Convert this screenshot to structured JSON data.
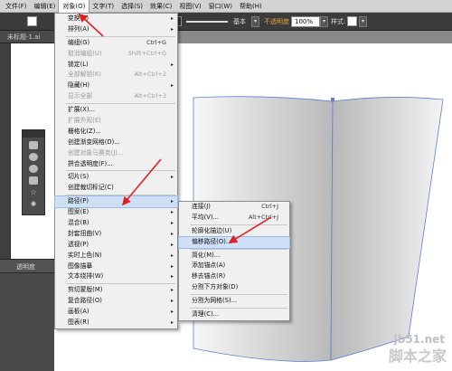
{
  "menubar": {
    "items": [
      "文件(F)",
      "编辑(E)",
      "对象(O)",
      "文字(T)",
      "选择(S)",
      "效果(C)",
      "视图(V)",
      "窗口(W)",
      "帮助(H)"
    ],
    "active_index": 2
  },
  "control_bar": {
    "stroke_profile": "基本",
    "opacity_label": "不透明度",
    "opacity_value": "100%",
    "style_label": "样式:"
  },
  "document_tab": "未标题-1.ai",
  "panel_header": "透明度",
  "object_menu": {
    "items": [
      {
        "label": "变换(T)",
        "submenu": true
      },
      {
        "label": "排列(A)",
        "submenu": true
      },
      {
        "sep": true
      },
      {
        "label": "编组(G)",
        "shortcut": "Ctrl+G"
      },
      {
        "label": "取消编组(U)",
        "shortcut": "Shift+Ctrl+G",
        "disabled": true
      },
      {
        "label": "锁定(L)",
        "submenu": true
      },
      {
        "label": "全部解锁(K)",
        "shortcut": "Alt+Ctrl+2",
        "disabled": true
      },
      {
        "label": "隐藏(H)",
        "submenu": true
      },
      {
        "label": "显示全部",
        "shortcut": "Alt+Ctrl+3",
        "disabled": true
      },
      {
        "sep": true
      },
      {
        "label": "扩展(X)..."
      },
      {
        "label": "扩展外观(E)",
        "disabled": true
      },
      {
        "label": "栅格化(Z)..."
      },
      {
        "label": "创建渐变网格(D)..."
      },
      {
        "label": "创建对象马赛克(J)...",
        "disabled": true
      },
      {
        "label": "拼合透明度(F)..."
      },
      {
        "sep": true
      },
      {
        "label": "切片(S)",
        "submenu": true
      },
      {
        "label": "创建裁切标记(C)"
      },
      {
        "sep": true
      },
      {
        "label": "路径(P)",
        "submenu": true,
        "highlight": true
      },
      {
        "label": "图案(E)",
        "submenu": true
      },
      {
        "label": "混合(B)",
        "submenu": true
      },
      {
        "label": "封套扭曲(V)",
        "submenu": true
      },
      {
        "label": "透视(P)",
        "submenu": true
      },
      {
        "label": "实时上色(N)",
        "submenu": true
      },
      {
        "label": "图像描摹",
        "submenu": true
      },
      {
        "label": "文本绕排(W)",
        "submenu": true
      },
      {
        "sep": true
      },
      {
        "label": "剪切蒙版(M)",
        "submenu": true
      },
      {
        "label": "复合路径(O)",
        "submenu": true
      },
      {
        "label": "画板(A)",
        "submenu": true
      },
      {
        "label": "图表(R)",
        "submenu": true
      }
    ]
  },
  "path_submenu": {
    "items": [
      {
        "label": "连接(J)",
        "shortcut": "Ctrl+J"
      },
      {
        "label": "平均(V)...",
        "shortcut": "Alt+Ctrl+J"
      },
      {
        "sep": true
      },
      {
        "label": "轮廓化描边(U)"
      },
      {
        "label": "偏移路径(O)...",
        "highlight": true
      },
      {
        "sep": true
      },
      {
        "label": "简化(M)..."
      },
      {
        "label": "添加锚点(A)"
      },
      {
        "label": "移去锚点(R)"
      },
      {
        "label": "分割下方对象(D)"
      },
      {
        "sep": true
      },
      {
        "label": "分割为网格(S)..."
      },
      {
        "sep": true
      },
      {
        "label": "清理(C)..."
      }
    ]
  },
  "watermark": {
    "site": "jb51.net",
    "brand": "脚本之家"
  },
  "colors": {
    "highlight": "#cfe0f6",
    "arrow": "#e02020",
    "shape_stroke": "#5b7fd1"
  }
}
